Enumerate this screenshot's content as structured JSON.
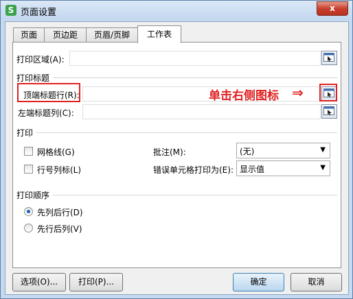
{
  "window": {
    "title": "页面设置",
    "app_icon_letter": "S",
    "close_label": "x"
  },
  "tabs": [
    {
      "label": "页面",
      "active": false
    },
    {
      "label": "页边距",
      "active": false
    },
    {
      "label": "页眉/页脚",
      "active": false
    },
    {
      "label": "工作表",
      "active": true
    }
  ],
  "print_area": {
    "label": "打印区域(A):",
    "value": ""
  },
  "print_titles": {
    "section_label": "打印标题",
    "top_rows_label": "顶端标题行(R):",
    "top_rows_value": "",
    "left_cols_label": "左端标题列(C):",
    "left_cols_value": ""
  },
  "print": {
    "section_label": "打印",
    "gridlines_label": "网格线(G)",
    "gridlines_checked": false,
    "row_col_headers_label": "行号列标(L)",
    "row_col_headers_checked": false,
    "comments_label": "批注(M):",
    "comments_value": "(无)",
    "errors_label": "错误单元格打印为(E):",
    "errors_value": "显示值"
  },
  "page_order": {
    "section_label": "打印顺序",
    "option1": "先列后行(D)",
    "option2": "先行后列(V)",
    "selected": "option1"
  },
  "annotation": {
    "text": "单击右侧图标",
    "arrow": "⇒",
    "color": "#e02020"
  },
  "buttons": {
    "options": "选项(O)...",
    "print": "打印(P)...",
    "ok": "确定",
    "cancel": "取消"
  }
}
